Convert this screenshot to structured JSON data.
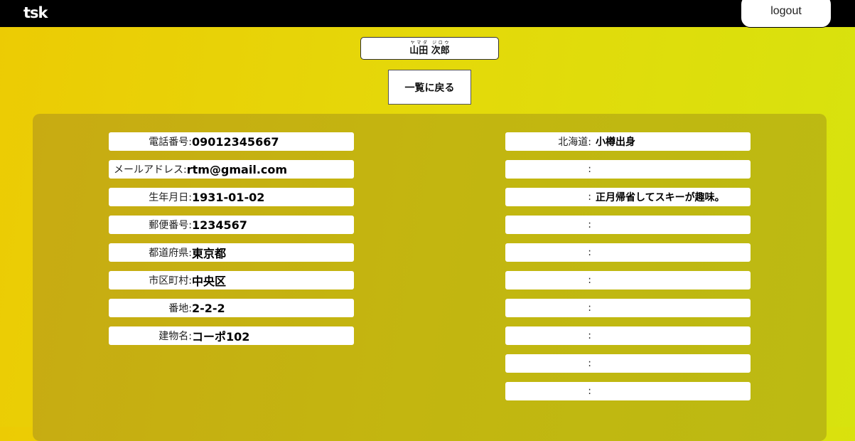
{
  "header": {
    "logo": "tsk",
    "logout_label": "logout"
  },
  "person": {
    "name": "山田 次郎",
    "furigana": "ヤマダ ジロウ"
  },
  "back_button_label": "一覧に戻る",
  "details": [
    {
      "label": "電話番号:",
      "value": "09012345667"
    },
    {
      "label": "メールアドレス:",
      "value": "rtm@gmail.com"
    },
    {
      "label": "生年月日:",
      "value": "1931-01-02"
    },
    {
      "label": "郵便番号:",
      "value": "1234567"
    },
    {
      "label": "都道府県:",
      "value": "東京都"
    },
    {
      "label": "市区町村:",
      "value": "中央区"
    },
    {
      "label": "番地:",
      "value": "2-2-2"
    },
    {
      "label": "建物名:",
      "value": "コーポ102"
    }
  ],
  "extras": [
    {
      "label": "北海道:",
      "value": "小樽出身"
    },
    {
      "label": ":",
      "value": ""
    },
    {
      "label": ":",
      "value": "正月帰省してスキーが趣味。"
    },
    {
      "label": ":",
      "value": ""
    },
    {
      "label": ":",
      "value": ""
    },
    {
      "label": ":",
      "value": ""
    },
    {
      "label": ":",
      "value": ""
    },
    {
      "label": ":",
      "value": ""
    },
    {
      "label": ":",
      "value": ""
    },
    {
      "label": ":",
      "value": ""
    }
  ]
}
